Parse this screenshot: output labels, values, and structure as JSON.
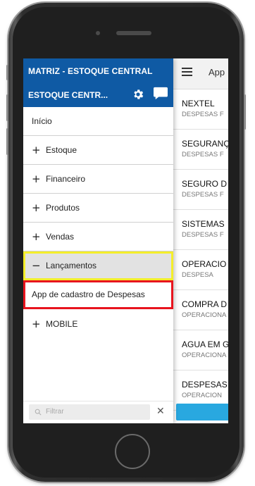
{
  "drawer": {
    "company": "MATRIZ - ESTOQUE CENTRAL",
    "store": "ESTOQUE CENTR...",
    "icons": {
      "settings": "gear-icon",
      "messages": "chat-icon"
    },
    "header_color": "#0f5aa4"
  },
  "menu": {
    "home": "Início",
    "estoque": "Estoque",
    "financeiro": "Financeiro",
    "produtos": "Produtos",
    "vendas": "Vendas",
    "lancamentos": "Lançamentos",
    "app_despesas": "App de cadastro de Despesas",
    "mobile": "MOBILE",
    "expand_sign": "+",
    "collapse_sign": "−"
  },
  "filter": {
    "placeholder": "Filtrar",
    "clear": "✕"
  },
  "app": {
    "title": "App",
    "items": [
      {
        "title": "NEXTEL",
        "subtitle": "DESPESAS F"
      },
      {
        "title": "SEGURANÇ",
        "subtitle": "DESPESAS F"
      },
      {
        "title": "SEGURO D",
        "subtitle": "DESPESAS F"
      },
      {
        "title": "SISTEMAS",
        "subtitle": "DESPESAS F"
      },
      {
        "title": "OPERACIO",
        "subtitle": "DESPESA"
      },
      {
        "title": "COMPRA D",
        "subtitle": "OPERACIONA"
      },
      {
        "title": "AGUA EM G",
        "subtitle": "OPERACIONA"
      },
      {
        "title": "DESPESAS",
        "subtitle": "OPERACION"
      }
    ],
    "accent_color": "#29a8e0"
  },
  "highlights": {
    "active_color": "#f4ee2a",
    "selected_color": "#e8141e"
  }
}
